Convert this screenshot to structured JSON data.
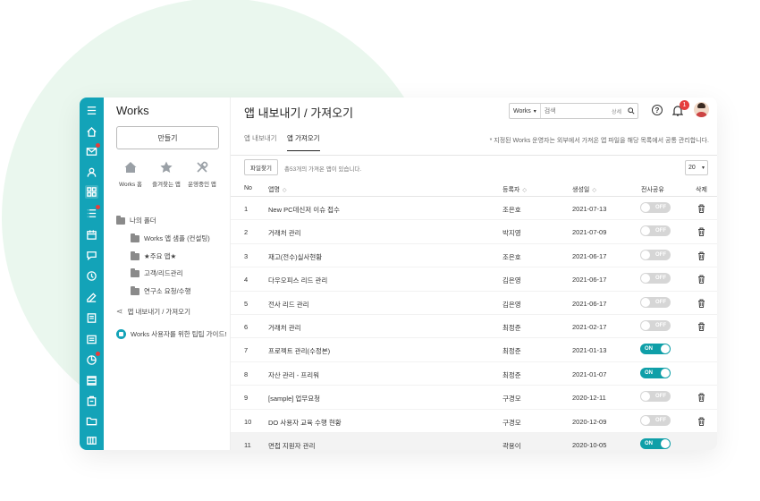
{
  "sidebar": {
    "title": "Works",
    "create_label": "만들기",
    "quick": [
      {
        "label": "Works 홈",
        "icon": "home-icon"
      },
      {
        "label": "즐겨찾는 앱",
        "icon": "star-icon"
      },
      {
        "label": "운영중인 앱",
        "icon": "tools-icon"
      }
    ],
    "my_folder": "나의 폴더",
    "folders": [
      "Works 앱 샘플 (컨설팅)",
      "★주요 앱★",
      "고객/리드관리",
      "연구소 요청/수행"
    ],
    "export_label": "앱 내보내기 / 가져오기",
    "guide_label": "Works 사용자를 위한 팁팁 가이드!"
  },
  "header": {
    "title": "앱 내보내기 / 가져오기",
    "search_scope": "Works",
    "search_placeholder": "검색",
    "search_detail": "상세",
    "notification_count": "1"
  },
  "tabs": [
    {
      "label": "앱 내보내기"
    },
    {
      "label": "앱 가져오기"
    }
  ],
  "notice": "* 지정된 Works 운영자는 외부에서 가져온 앱 파일을 해당 목록에서 공통 관리합니다.",
  "toolbar": {
    "find_label": "파일찾기",
    "count_text": "총53개의 가져온 앱이 있습니다.",
    "page_size": "20"
  },
  "table": {
    "columns": [
      "No",
      "앱명",
      "등록자",
      "생성일",
      "전사공유",
      "삭제"
    ],
    "rows": [
      {
        "no": "1",
        "name": "New PC데신저 이슈 접수",
        "owner": "조은호",
        "date": "2021-07-13",
        "share": "OFF",
        "trash": true
      },
      {
        "no": "2",
        "name": "거래처 관리",
        "owner": "박지영",
        "date": "2021-07-09",
        "share": "OFF",
        "trash": true
      },
      {
        "no": "3",
        "name": "재고(전수)실사현황",
        "owner": "조은호",
        "date": "2021-06-17",
        "share": "OFF",
        "trash": true
      },
      {
        "no": "4",
        "name": "다우오피스 리드 관리",
        "owner": "김은영",
        "date": "2021-06-17",
        "share": "OFF",
        "trash": true
      },
      {
        "no": "5",
        "name": "전사 리드 관리",
        "owner": "김은영",
        "date": "2021-06-17",
        "share": "OFF",
        "trash": true
      },
      {
        "no": "6",
        "name": "거래처 관리",
        "owner": "최정준",
        "date": "2021-02-17",
        "share": "OFF",
        "trash": true
      },
      {
        "no": "7",
        "name": "프로젝트 관리(수정본)",
        "owner": "최정준",
        "date": "2021-01-13",
        "share": "ON",
        "trash": false
      },
      {
        "no": "8",
        "name": "자산 관리 - 프리워",
        "owner": "최정준",
        "date": "2021-01-07",
        "share": "ON",
        "trash": false
      },
      {
        "no": "9",
        "name": "[sample] 업무요청",
        "owner": "구경모",
        "date": "2020-12-11",
        "share": "OFF",
        "trash": true
      },
      {
        "no": "10",
        "name": "DO 사용자 교육 수행 현황",
        "owner": "구경모",
        "date": "2020-12-09",
        "share": "OFF",
        "trash": true
      },
      {
        "no": "11",
        "name": "면접 지원자 관리",
        "owner": "곽용이",
        "date": "2020-10-05",
        "share": "ON",
        "trash": false
      }
    ]
  },
  "colors": {
    "accent": "#13a3b8",
    "toggle_on": "#0f9fa8",
    "badge": "#e53e3e",
    "background_circle": "#eaf7ee"
  }
}
